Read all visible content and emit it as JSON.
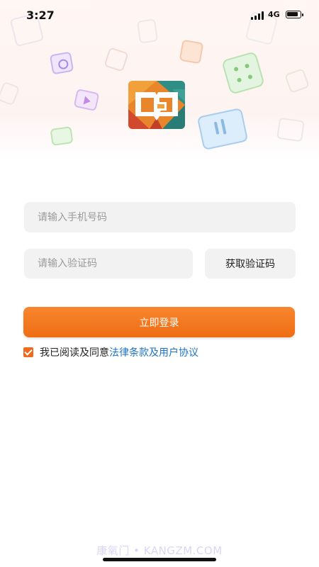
{
  "status_bar": {
    "time": "3:27",
    "network": "4G"
  },
  "logo": {
    "icon": "book-chat-icon",
    "colors": [
      "#e9852a",
      "#2f8e86",
      "#d14a2f",
      "#f2b233"
    ]
  },
  "form": {
    "phone_placeholder": "请输入手机号码",
    "code_placeholder": "请输入验证码",
    "get_code_label": "获取验证码",
    "login_label": "立即登录"
  },
  "agreement": {
    "checked": true,
    "text": "我已阅读及同意",
    "link": "法律条款及用户协议"
  },
  "watermark": "康氧门 • KANGZM.COM",
  "colors": {
    "accent": "#ee6d14",
    "link": "#1e72c4",
    "field_bg": "#f2f2f2"
  }
}
